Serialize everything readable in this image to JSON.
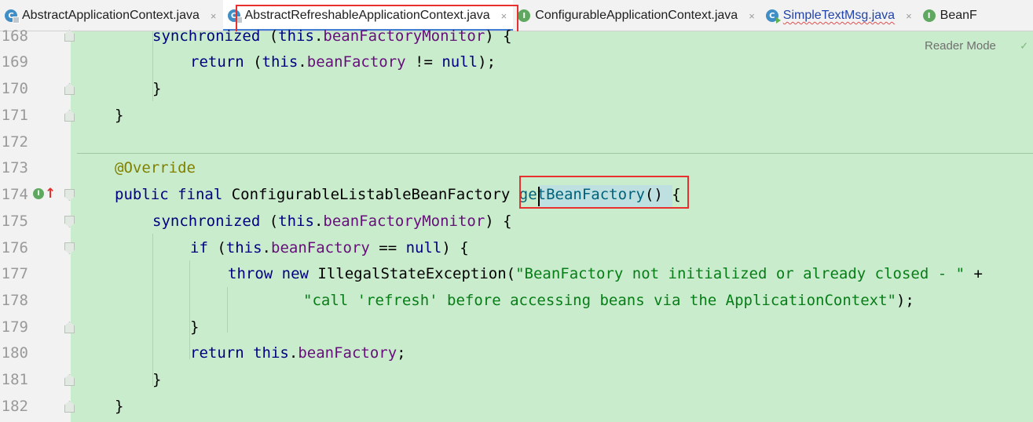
{
  "tabs": [
    {
      "label": "AbstractApplicationContext.java",
      "icon": "abstract-class-icon",
      "active": false
    },
    {
      "label": "AbstractRefreshableApplicationContext.java",
      "icon": "abstract-class-icon",
      "active": true
    },
    {
      "label": "ConfigurableApplicationContext.java",
      "icon": "interface-icon",
      "active": false
    },
    {
      "label": "SimpleTextMsg.java",
      "icon": "runnable-class-icon",
      "active": false
    },
    {
      "label": "BeanF",
      "icon": "interface-icon",
      "active": false
    }
  ],
  "tab_close": "×",
  "icon_letters": {
    "class": "C",
    "interface": "I"
  },
  "editor": {
    "reader_mode": "Reader Mode",
    "check": "✓",
    "override_arrow": "↑",
    "lines": [
      {
        "n": "168",
        "t": [
          "synchronized",
          " (",
          "this",
          ".",
          "beanFactoryMonitor",
          ") {"
        ]
      },
      {
        "n": "169",
        "t": [
          "return",
          " (",
          "this",
          ".",
          "beanFactory",
          " != ",
          "null",
          ");"
        ]
      },
      {
        "n": "170",
        "t": [
          "}"
        ]
      },
      {
        "n": "171",
        "t": [
          "}"
        ]
      },
      {
        "n": "172",
        "t": []
      },
      {
        "n": "173",
        "t": [
          "@Override"
        ]
      },
      {
        "n": "174",
        "t": [
          "public",
          " ",
          "final",
          " ConfigurableListableBeanFactory ",
          "getBeanFactory",
          "() {"
        ]
      },
      {
        "n": "175",
        "t": [
          "synchronized",
          " (",
          "this",
          ".",
          "beanFactoryMonitor",
          ") {"
        ]
      },
      {
        "n": "176",
        "t": [
          "if",
          " (",
          "this",
          ".",
          "beanFactory",
          " == ",
          "null",
          ") {"
        ]
      },
      {
        "n": "177",
        "t": [
          "throw",
          " ",
          "new",
          " IllegalStateException(",
          "\"BeanFactory not initialized or already closed - \"",
          " +"
        ]
      },
      {
        "n": "178",
        "t": [
          "\"call 'refresh' before accessing beans via the ApplicationContext\"",
          ");"
        ]
      },
      {
        "n": "179",
        "t": [
          "}"
        ]
      },
      {
        "n": "180",
        "t": [
          "return",
          " ",
          "this",
          ".",
          "beanFactory",
          ";"
        ]
      },
      {
        "n": "181",
        "t": [
          "}"
        ]
      },
      {
        "n": "182",
        "t": [
          "}"
        ]
      }
    ]
  }
}
